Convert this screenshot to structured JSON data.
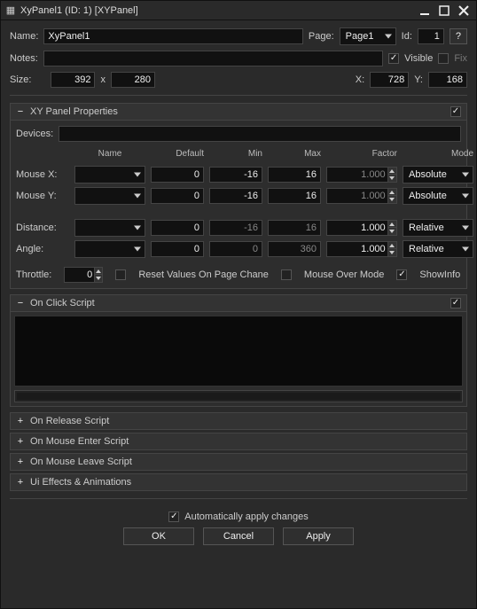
{
  "titlebar": {
    "icon_glyph": "▦",
    "title": "XyPanel1 (ID: 1) [XYPanel]"
  },
  "header": {
    "name_label": "Name:",
    "name_value": "XyPanel1",
    "page_label": "Page:",
    "page_value": "Page1",
    "id_label": "Id:",
    "id_value": "1",
    "help_label": "?",
    "notes_label": "Notes:",
    "notes_value": "",
    "visible_label": "Visible",
    "visible_checked": true,
    "fix_label": "Fix",
    "fix_checked": false,
    "size_label": "Size:",
    "size_w": "392",
    "size_x_sep": "x",
    "size_h": "280",
    "x_label": "X:",
    "x_value": "728",
    "y_label": "Y:",
    "y_value": "168"
  },
  "xy_panel": {
    "title": "XY Panel Properties",
    "side_checked": true,
    "devices_label": "Devices:",
    "devices_value": "",
    "col_name": "Name",
    "col_default": "Default",
    "col_min": "Min",
    "col_max": "Max",
    "col_factor": "Factor",
    "col_mode": "Mode",
    "rows": [
      {
        "label": "Mouse X:",
        "name": "",
        "default": "0",
        "min": "-16",
        "max": "16",
        "factor": "1.000",
        "mode": "Absolute",
        "factor_readonly": true
      },
      {
        "label": "Mouse Y:",
        "name": "",
        "default": "0",
        "min": "-16",
        "max": "16",
        "factor": "1.000",
        "mode": "Absolute",
        "factor_readonly": true
      },
      {
        "label": "Distance:",
        "name": "",
        "default": "0",
        "min": "-16",
        "max": "16",
        "factor": "1.000",
        "mode": "Relative",
        "factor_readonly": false,
        "min_readonly": true,
        "max_readonly": true
      },
      {
        "label": "Angle:",
        "name": "",
        "default": "0",
        "min": "0",
        "max": "360",
        "factor": "1.000",
        "mode": "Relative",
        "factor_readonly": false,
        "min_readonly": true,
        "max_readonly": true
      }
    ],
    "throttle_label": "Throttle:",
    "throttle_value": "0",
    "reset_label": "Reset Values On Page Chane",
    "reset_checked": false,
    "mouseover_label": "Mouse Over Mode",
    "mouseover_checked": false,
    "showinfo_label": "ShowInfo",
    "showinfo_checked": true
  },
  "scripts": {
    "onclick_title": "On Click Script",
    "onclick_side_checked": true,
    "onrelease_title": "On Release Script",
    "onmouseenter_title": "On Mouse Enter Script",
    "onmouseleave_title": "On Mouse Leave Script",
    "uieffects_title": "Ui Effects & Animations"
  },
  "footer": {
    "auto_apply_label": "Automatically apply changes",
    "auto_apply_checked": true,
    "ok": "OK",
    "cancel": "Cancel",
    "apply": "Apply"
  }
}
